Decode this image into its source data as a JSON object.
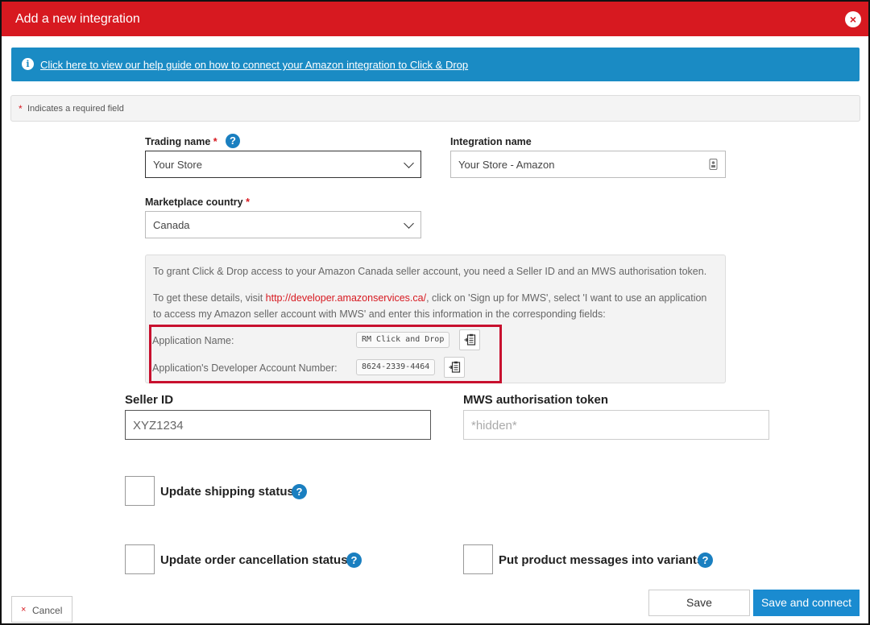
{
  "dialog": {
    "title": "Add a new integration",
    "close_symbol": "×"
  },
  "help_banner": {
    "icon": "i",
    "link_text": "Click here to view our help guide on how to connect your Amazon integration to Click & Drop"
  },
  "required_note": {
    "star": "*",
    "text": "Indicates a required field"
  },
  "form": {
    "trading_name": {
      "label": "Trading name",
      "required_marker": "*",
      "help": "?",
      "value": "Your Store"
    },
    "integration_name": {
      "label": "Integration name",
      "value": "Your Store - Amazon"
    },
    "marketplace_country": {
      "label": "Marketplace country",
      "required_marker": "*",
      "value": "Canada"
    }
  },
  "info_box": {
    "line1": "To grant Click & Drop access to your Amazon Canada seller account, you need a Seller ID and an MWS authorisation token.",
    "line2_prefix": "To get these details, visit ",
    "line2_link": "http://developer.amazonservices.ca/",
    "line2_suffix": ", click on 'Sign up for MWS', select 'I want to use an application to access my Amazon seller account with MWS' and enter this information in the corresponding fields:",
    "app_name_label": "Application Name:",
    "app_name_value": "RM Click and Drop",
    "dev_account_label": "Application's Developer Account Number:",
    "dev_account_value": "8624-2339-4464"
  },
  "credentials": {
    "seller_id": {
      "label": "Seller ID",
      "value": "XYZ1234"
    },
    "mws_token": {
      "label": "MWS authorisation token",
      "placeholder": "*hidden*"
    }
  },
  "options": {
    "update_shipping": {
      "label": "Update shipping status",
      "help": "?"
    },
    "update_cancellation": {
      "label": "Update order cancellation status",
      "help": "?"
    },
    "product_messages": {
      "label": "Put product messages into variants",
      "help": "?"
    }
  },
  "footer": {
    "cancel_symbol": "×",
    "cancel_label": "Cancel",
    "save_label": "Save",
    "save_connect_label": "Save and connect"
  },
  "colors": {
    "brand_red": "#d71920",
    "banner_blue": "#1a8bc4",
    "primary_button": "#1a8bd0"
  }
}
